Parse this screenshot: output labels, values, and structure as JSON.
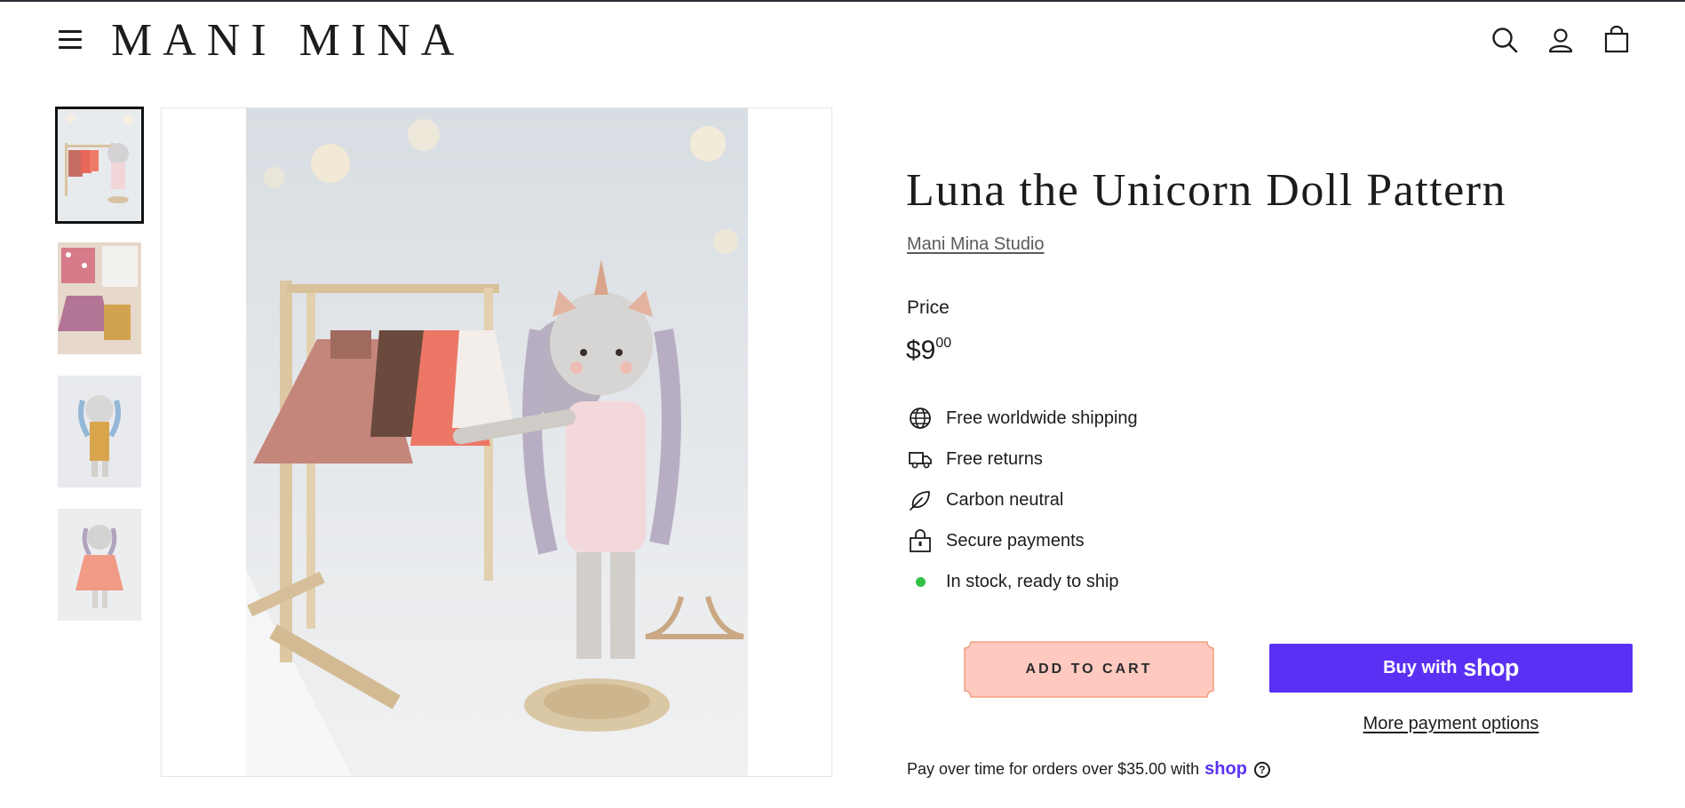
{
  "brand": {
    "logo_text": "MANI MINA"
  },
  "header": {
    "menu_icon": "hamburger-menu-icon",
    "search_icon": "search-icon",
    "account_icon": "user-icon",
    "cart_icon": "shopping-bag-icon"
  },
  "gallery": {
    "thumbnails": [
      {
        "alt": "Unicorn doll beside clothing rack",
        "active": true
      },
      {
        "alt": "Doll outfits laid flat",
        "active": false
      },
      {
        "alt": "Blue-haired unicorn doll",
        "active": false
      },
      {
        "alt": "Unicorn doll in pink dress",
        "active": false
      }
    ],
    "main_alt": "Luna the unicorn doll standing next to a wooden clothes rack"
  },
  "product": {
    "title": "Luna the Unicorn Doll Pattern",
    "vendor": "Mani Mina Studio",
    "price_label": "Price",
    "price_main": "$9",
    "price_cents": "00",
    "features": [
      {
        "icon": "globe-icon",
        "text": "Free worldwide shipping"
      },
      {
        "icon": "truck-icon",
        "text": "Free returns"
      },
      {
        "icon": "leaf-icon",
        "text": "Carbon neutral"
      },
      {
        "icon": "lock-icon",
        "text": "Secure payments"
      },
      {
        "icon": "in-stock-dot-icon",
        "text": "In stock, ready to ship"
      }
    ],
    "add_to_cart": "ADD TO CART",
    "buy_with": "Buy with",
    "buy_with_brand": "shop",
    "more_payment": "More payment options",
    "pay_over_time": "Pay over time for orders over $35.00 with",
    "pay_over_brand": "shop",
    "help_symbol": "?"
  },
  "colors": {
    "accent_shop": "#5a31f4",
    "cart_button_fill": "#ffc9c0",
    "cart_button_border": "#f0a07f",
    "in_stock": "#34c246"
  }
}
